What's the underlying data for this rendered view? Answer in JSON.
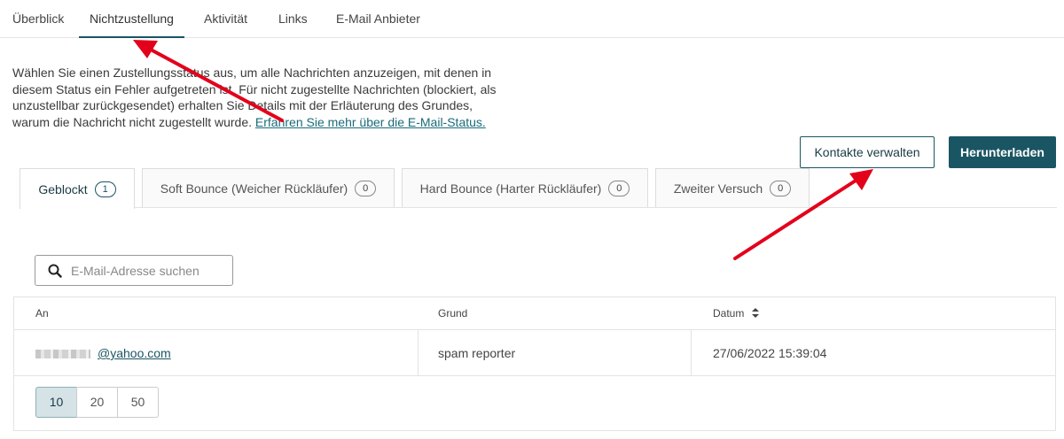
{
  "nav": {
    "tabs": [
      {
        "label": "Überblick"
      },
      {
        "label": "Nichtzustellung"
      },
      {
        "label": "Aktivität"
      },
      {
        "label": "Links"
      },
      {
        "label": "E-Mail Anbieter"
      }
    ],
    "active": "Nichtzustellung"
  },
  "intro": {
    "text": "Wählen Sie einen Zustellungsstatus aus, um alle Nachrichten anzuzeigen, mit denen in diesem Status ein Fehler aufgetreten ist. Für nicht zugestellte Nachrichten (blockiert, als unzustellbar zurückgesendet) erhalten Sie Details mit der Erläuterung des Grundes, warum die Nachricht nicht zugestellt wurde.",
    "link": "Erfahren Sie mehr über die E-Mail-Status."
  },
  "actions": {
    "manage_contacts": "Kontakte verwalten",
    "download": "Herunterladen"
  },
  "status_tabs": [
    {
      "label": "Geblockt",
      "count": "1"
    },
    {
      "label": "Soft Bounce (Weicher Rückläufer)",
      "count": "0"
    },
    {
      "label": "Hard Bounce (Harter Rückläufer)",
      "count": "0"
    },
    {
      "label": "Zweiter Versuch",
      "count": "0"
    }
  ],
  "search": {
    "placeholder": "E-Mail-Adresse suchen"
  },
  "table": {
    "headers": {
      "to": "An",
      "reason": "Grund",
      "date": "Datum"
    },
    "rows": [
      {
        "email": "@yahoo.com",
        "reason": "spam reporter",
        "date": "27/06/2022 15:39:04"
      }
    ]
  },
  "pagination": {
    "options": [
      "10",
      "20",
      "50"
    ],
    "selected": "10"
  },
  "colors": {
    "accent": "#1a5563",
    "annotation": "#e3001b"
  },
  "icons": {
    "search": "search-icon",
    "sort": "sort-icon"
  }
}
